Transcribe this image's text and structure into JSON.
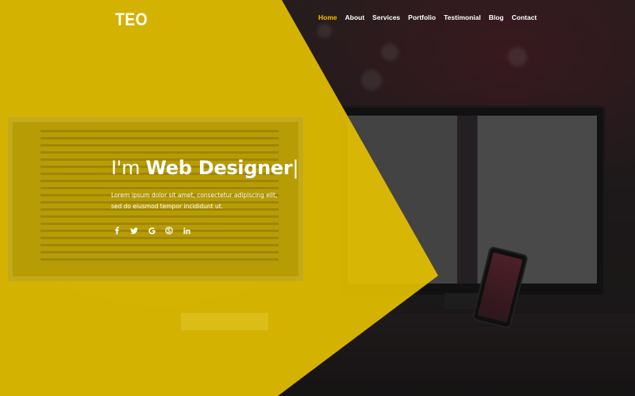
{
  "header": {
    "logo": "TEO",
    "nav": [
      {
        "label": "Home",
        "active": true
      },
      {
        "label": "About",
        "active": false
      },
      {
        "label": "Services",
        "active": false
      },
      {
        "label": "Portfolio",
        "active": false
      },
      {
        "label": "Testimonial",
        "active": false
      },
      {
        "label": "Blog",
        "active": false
      },
      {
        "label": "Contact",
        "active": false
      }
    ]
  },
  "hero": {
    "title_light": "I'm ",
    "title_strong": "Web Designer",
    "title_cursor": "|",
    "description": "Lorem ipsum dolor sit amet, consectetur adipiscing elit, sed do eiusmod tempor incididunt ut."
  },
  "social": [
    {
      "icon": "facebook-icon",
      "glyph": "f"
    },
    {
      "icon": "twitter-icon",
      "glyph": "🐦"
    },
    {
      "icon": "google-icon",
      "glyph": "G"
    },
    {
      "icon": "skype-icon",
      "glyph": "S"
    },
    {
      "icon": "linkedin-icon",
      "glyph": "in"
    }
  ],
  "colors": {
    "accent": "#f2c500",
    "overlay_yellow": "#e8c300",
    "text": "#ffffff"
  }
}
